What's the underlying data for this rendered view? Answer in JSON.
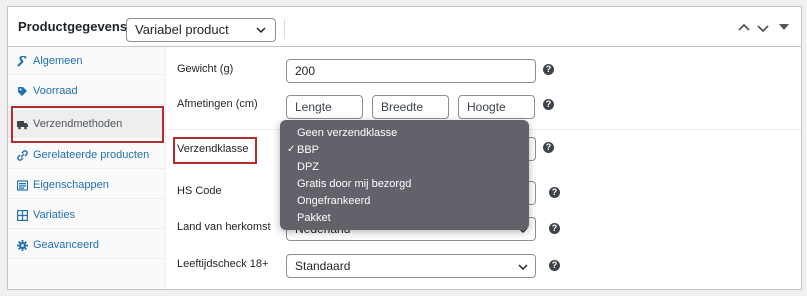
{
  "header": {
    "title": "Productgegevens —",
    "product_type": "Variabel product"
  },
  "sidebar": {
    "items": [
      {
        "label": "Algemeen",
        "icon": "wrench-icon"
      },
      {
        "label": "Voorraad",
        "icon": "tag-icon"
      },
      {
        "label": "Verzendmethoden",
        "icon": "truck-icon",
        "active": true
      },
      {
        "label": "Gerelateerde producten",
        "icon": "link-icon"
      },
      {
        "label": "Eigenschappen",
        "icon": "list-icon"
      },
      {
        "label": "Variaties",
        "icon": "grid-icon"
      },
      {
        "label": "Geavanceerd",
        "icon": "gear-icon"
      }
    ]
  },
  "fields": {
    "weight": {
      "label": "Gewicht (g)",
      "value": "200"
    },
    "dimensions": {
      "label": "Afmetingen (cm)",
      "length_placeholder": "Lengte",
      "width_placeholder": "Breedte",
      "height_placeholder": "Hoogte"
    },
    "shipping_class": {
      "label": "Verzendklasse"
    },
    "hs_code": {
      "label": "HS Code"
    },
    "origin": {
      "label": "Land van herkomst",
      "value": "Nederland"
    },
    "age_check": {
      "label": "Leeftijdscheck 18+",
      "value": "Standaard"
    }
  },
  "dropdown": {
    "options": [
      "Geen verzendklasse",
      "BBP",
      "DPZ",
      "Gratis door mij bezorgd",
      "Ongefrankeerd",
      "Pakket"
    ],
    "selected": "BBP",
    "check": "✓"
  },
  "help_glyph": "?",
  "colors": {
    "link": "#2271b1",
    "highlight": "#b32d2e",
    "dropdown_bg": "#62626a"
  }
}
